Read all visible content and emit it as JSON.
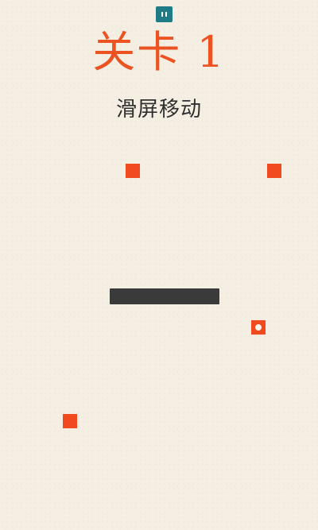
{
  "game": {
    "level_title": "关卡 1",
    "instruction": "滑屏移动",
    "pause_icon": "pause-icon",
    "colors": {
      "background": "#f5efe3",
      "accent": "#ec5322",
      "block": "#f04a1e",
      "paddle": "#3a3a3a",
      "pause_button": "#1f7c86",
      "text": "#2f2f2f"
    }
  }
}
